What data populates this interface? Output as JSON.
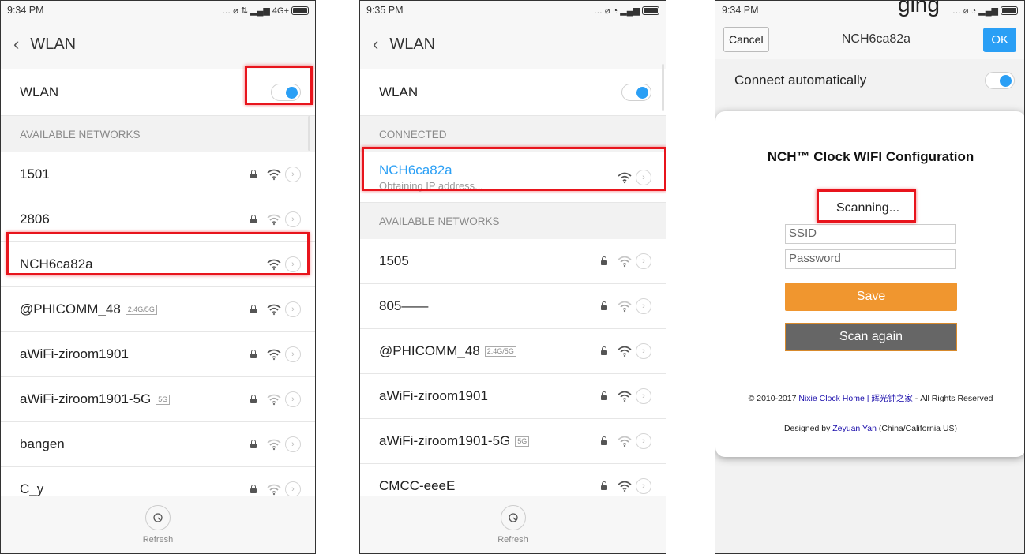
{
  "phone1": {
    "time": "9:34 PM",
    "status_icons": "… ⌀ ⇅ ▂▄▆ 4G+",
    "title": "WLAN",
    "wlan_label": "WLAN",
    "section": "AVAILABLE NETWORKS",
    "networks": [
      {
        "name": "1501",
        "tag": "",
        "locked": true,
        "signal": "strong"
      },
      {
        "name": "2806",
        "tag": "",
        "locked": true,
        "signal": "weak"
      },
      {
        "name": "NCH6ca82a",
        "tag": "",
        "locked": false,
        "signal": "strong"
      },
      {
        "name": "@PHICOMM_48",
        "tag": "2.4G/5G",
        "locked": true,
        "signal": "strong"
      },
      {
        "name": "aWiFi-ziroom1901",
        "tag": "",
        "locked": true,
        "signal": "strong"
      },
      {
        "name": "aWiFi-ziroom1901-5G",
        "tag": "5G",
        "locked": true,
        "signal": "weak"
      },
      {
        "name": "bangen",
        "tag": "",
        "locked": true,
        "signal": "weak"
      },
      {
        "name": "C_y",
        "tag": "",
        "locked": true,
        "signal": "weak"
      }
    ],
    "refresh": "Refresh"
  },
  "phone2": {
    "time": "9:35 PM",
    "status_icons": "… ⌀ ◔ ▂▄▆",
    "title": "WLAN",
    "wlan_label": "WLAN",
    "connected_section": "CONNECTED",
    "connected_name": "NCH6ca82a",
    "connected_status": "Obtaining IP address...",
    "section": "AVAILABLE NETWORKS",
    "networks": [
      {
        "name": "1505",
        "tag": "",
        "locked": true,
        "signal": "weak"
      },
      {
        "name": "805——",
        "tag": "",
        "locked": true,
        "signal": "weak"
      },
      {
        "name": "@PHICOMM_48",
        "tag": "2.4G/5G",
        "locked": true,
        "signal": "strong"
      },
      {
        "name": "aWiFi-ziroom1901",
        "tag": "",
        "locked": true,
        "signal": "strong"
      },
      {
        "name": "aWiFi-ziroom1901-5G",
        "tag": "5G",
        "locked": true,
        "signal": "weak"
      },
      {
        "name": "CMCC-eeeE",
        "tag": "",
        "locked": true,
        "signal": "strong"
      }
    ],
    "refresh": "Refresh"
  },
  "phone3": {
    "time": "9:34 PM",
    "status_icons": "… ⌀ ◔ ▂▄▆",
    "cancel": "Cancel",
    "title": "NCH6ca82a",
    "ok": "OK",
    "auto_connect": "Connect automatically",
    "card_title": "NCH™ Clock WIFI Configuration",
    "scanning": "Scanning...",
    "ssid_placeholder": "SSID",
    "password_placeholder": "Password",
    "save": "Save",
    "scan_again": "Scan again",
    "footer_prefix": "© 2010-2017 ",
    "footer_link": "Nixie Clock Home | 辉光钟之家",
    "footer_suffix": " - All Rights Reserved",
    "designed_prefix": "Designed by ",
    "designed_link": "Zeyuan Yan",
    "designed_suffix": " (China/California US)"
  },
  "clipped_text": "ging",
  "colors": {
    "accent": "#2a9ff5",
    "highlight": "#e8141c",
    "save": "#f0962f",
    "scan": "#666666"
  }
}
